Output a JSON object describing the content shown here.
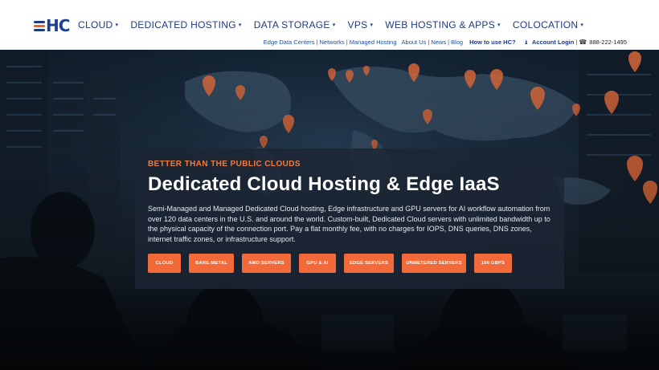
{
  "logo": {
    "text": "HC"
  },
  "main_nav": [
    {
      "label": "CLOUD"
    },
    {
      "label": "DEDICATED HOSTING"
    },
    {
      "label": "DATA STORAGE"
    },
    {
      "label": "VPS"
    },
    {
      "label": "WEB HOSTING & APPS"
    },
    {
      "label": "COLOCATION"
    }
  ],
  "sub_nav": {
    "edge": "Edge Data Centers",
    "networks": "Networks",
    "managed": "Managed Hosting",
    "about": "About Us",
    "news": "News",
    "blog": "Blog",
    "how": "How to use HC?",
    "login": "Account Login",
    "phone": "888-222-1495"
  },
  "hero": {
    "eyebrow": "BETTER THAN THE PUBLIC CLOUDS",
    "headline": "Dedicated Cloud Hosting & Edge IaaS",
    "description": "Semi-Managed and Managed Dedicated Cloud hosting, Edge infrastructure and GPU servers for AI workflow automation from over 120 data centers in the U.S. and around the world. Custom-built, Dedicated Cloud servers with unlimited bandwidth up to the physical capacity of the connection port. Pay a flat monthly fee, with no charges for IOPS, DNS queries, DNS zones, internet traffic zones, or infrastructure support.",
    "buttons": [
      {
        "label": "CLOUD"
      },
      {
        "label": "BARE-METAL"
      },
      {
        "label": "AMD SERVERS"
      },
      {
        "label": "GPU & AI"
      },
      {
        "label": "EDGE SERVERS"
      },
      {
        "label": "UNMETERED SERVERS"
      },
      {
        "label": "100 GBPS"
      }
    ]
  },
  "colors": {
    "brand_blue": "#1e3a82",
    "accent_orange": "#f26a3a",
    "eyebrow_orange": "#f37a3a",
    "panel_bg": "#1c2634"
  },
  "icons": {
    "caret": "chevron-down-icon",
    "user": "user-icon",
    "phone": "phone-icon"
  }
}
